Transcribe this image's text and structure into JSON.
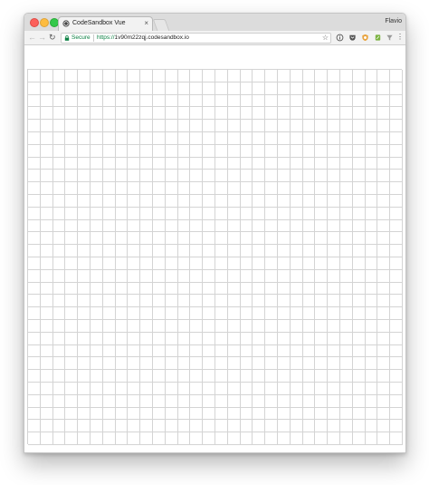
{
  "window": {
    "tab": {
      "title": "CodeSandbox Vue",
      "close_label": "×",
      "icon": "codesandbox-icon"
    },
    "profile_name": "Flavio"
  },
  "toolbar": {
    "back_label": "←",
    "forward_label": "→",
    "reload_label": "↻",
    "security_label": "Secure",
    "url_protocol": "https://",
    "url_host": "1v90m22zqj.codesandbox.io",
    "bookmark_label": "☆",
    "menu_label": "⋮",
    "extensions": [
      "info-icon",
      "pocket-icon",
      "shield-extension-icon",
      "pen-extension-icon",
      "filter-extension-icon"
    ]
  },
  "grid": {
    "rows": 30,
    "columns": 30
  },
  "colors": {
    "secure_green": "#0b8043",
    "grid_line": "#d4d4d4"
  }
}
